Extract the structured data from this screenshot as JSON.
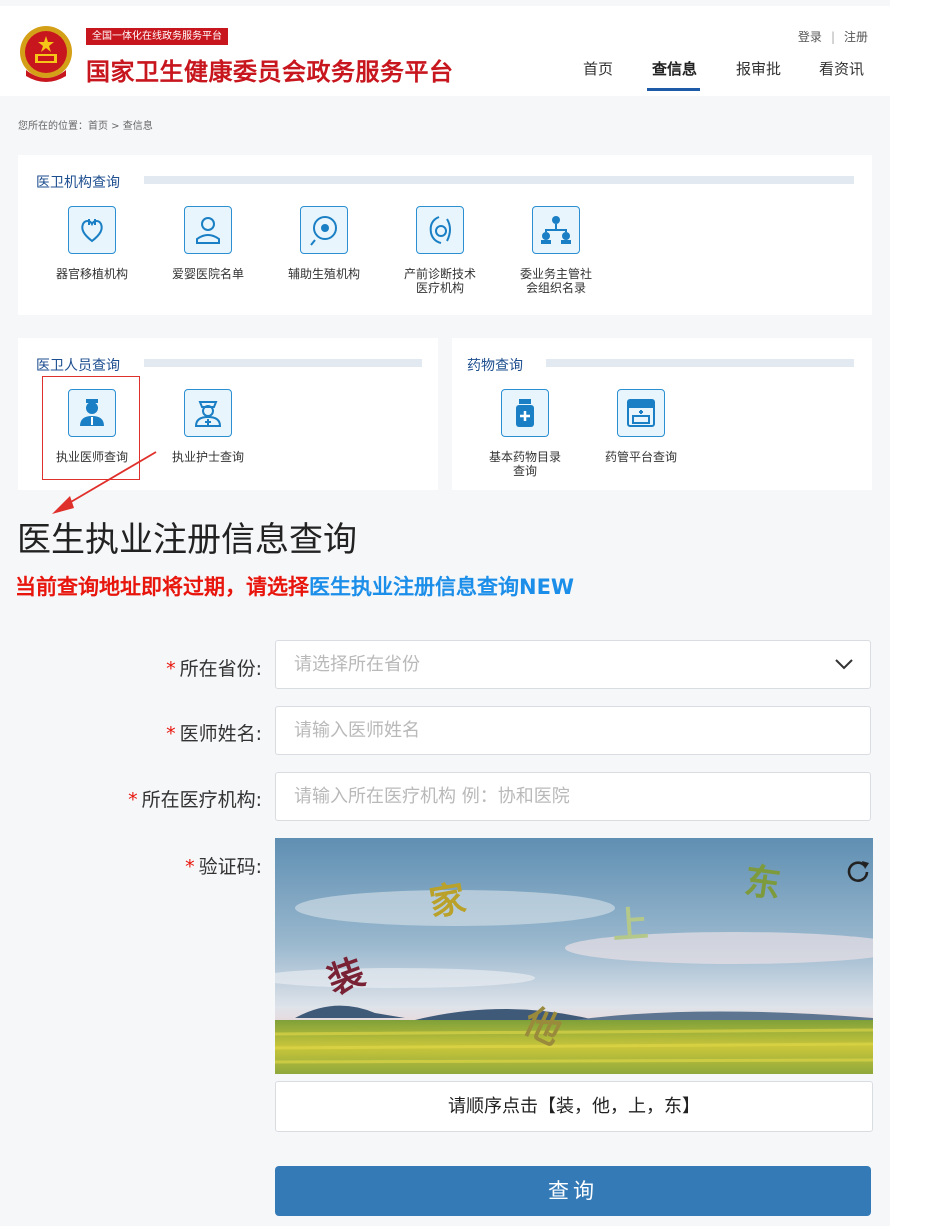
{
  "header": {
    "platform_badge": "全国一体化在线政务服务平台",
    "site_title": "国家卫生健康委员会政务服务平台",
    "login": "登录",
    "separator": "|",
    "register": "注册",
    "nav": [
      "首页",
      "查信息",
      "报审批",
      "看资讯"
    ],
    "active_nav": "查信息"
  },
  "breadcrumb": "您所在的位置：首页 > 查信息",
  "sections": {
    "institutions": {
      "title": "医卫机构查询",
      "items": [
        {
          "label": "器官移植机构",
          "icon": "heart-organ-icon"
        },
        {
          "label": "爱婴医院名单",
          "icon": "baby-icon"
        },
        {
          "label": "辅助生殖机构",
          "icon": "embryo-icon"
        },
        {
          "label": "产前诊断技术医疗机构",
          "icon": "pregnancy-icon"
        },
        {
          "label": "委业务主管社会组织名录",
          "icon": "organization-icon"
        }
      ]
    },
    "personnel": {
      "title": "医卫人员查询",
      "items": [
        {
          "label": "执业医师查询",
          "icon": "doctor-icon"
        },
        {
          "label": "执业护士查询",
          "icon": "nurse-icon"
        }
      ]
    },
    "drugs": {
      "title": "药物查询",
      "items": [
        {
          "label": "基本药物目录查询",
          "icon": "medicine-bottle-icon"
        },
        {
          "label": "药管平台查询",
          "icon": "pharmacy-icon"
        }
      ]
    }
  },
  "form": {
    "title": "医生执业注册信息查询",
    "notice_prefix": "当前查询地址即将过期，请选择",
    "notice_link": "医生执业注册信息查询NEW",
    "required_mark": "*",
    "province_label": "所在省份:",
    "province_placeholder": "请选择所在省份",
    "name_label": "医师姓名:",
    "name_placeholder": "请输入医师姓名",
    "org_label": "所在医疗机构:",
    "org_placeholder": "请输入所在医疗机构  例：协和医院",
    "captcha_label": "验证码:",
    "captcha_chars": [
      "家",
      "东",
      "上",
      "装",
      "他"
    ],
    "captcha_hint": "请顺序点击【装，他，上，东】",
    "submit": "查询"
  },
  "colors": {
    "brand_red": "#c8161e",
    "nav_blue": "#1d5aa7",
    "link_blue": "#1a8ee9",
    "notice_red": "#e8150c",
    "submit_blue": "#337ab7"
  }
}
